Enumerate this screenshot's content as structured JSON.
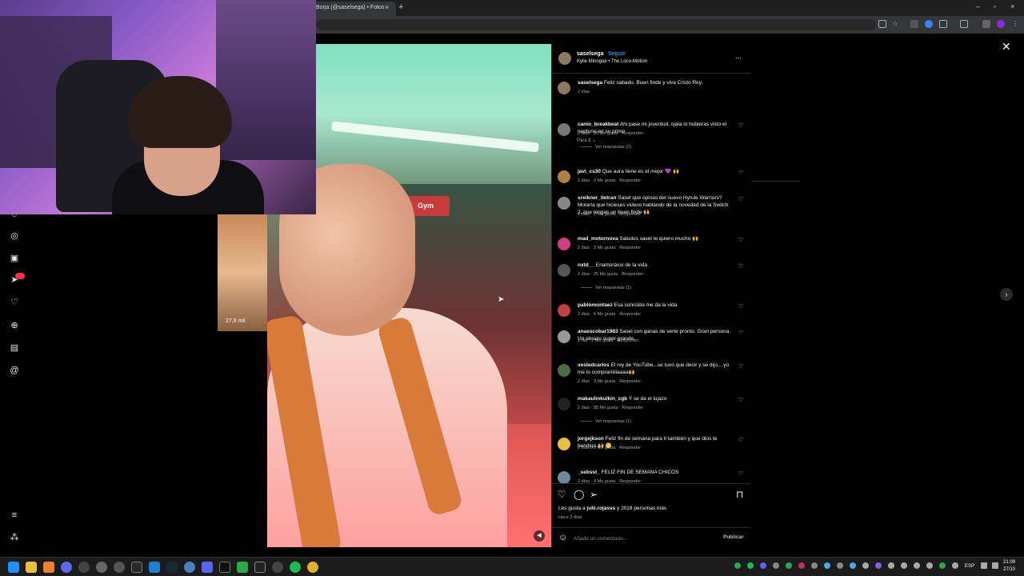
{
  "browser": {
    "tab_title": "Borja (@saselsega) • Fotos",
    "tab_close": "×",
    "new_tab": "+",
    "window_controls": [
      "–",
      "▫",
      "×"
    ]
  },
  "post": {
    "username": "saselsega",
    "follow_label": "Seguir",
    "song": "Kylie Minogue • The Loco-Motion",
    "more": "...",
    "mute_icon": "speaker-icon"
  },
  "thumbnail": {
    "views": "27,6 mil"
  },
  "caption": {
    "user": "saselsega",
    "text": "Feliz sabado. Buen finde y viva Cristo Rey.",
    "time": "2 días"
  },
  "sort_label": "Para ti",
  "comments": [
    {
      "user": "canio_breakbeat",
      "text": "Ahi pase mi juventud, ojala lo hubieras visto el neptuno en su prime",
      "time": "2 días",
      "likes": "16 Me gusta",
      "reply": "Responder",
      "replies": "Ver respuestas (2)"
    },
    {
      "user": "javi_cs30",
      "text": "Que aura tiene es el mejor 💜 🙌",
      "time": "2 días",
      "likes": "2 Me gusta",
      "reply": "Responder"
    },
    {
      "user": "sreikner_lletran",
      "text": "Sasel que opinas del nuevo Hyrule Warriors? Molaría que hicieses videos hablando de la novedad de la Switch 2, que tengas un buen finde 🙌",
      "time": "2 días",
      "likes": "2 Me gusta",
      "reply": "Responder"
    },
    {
      "user": "mad_motornova",
      "text": "Saludos sasel te quiero mucho 🙌",
      "time": "2 días",
      "likes": "3 Me gusta",
      "reply": "Responder"
    },
    {
      "user": "nxtd__",
      "text": "Enamoraico de la vida",
      "time": "2 días",
      "likes": "25 Me gusta",
      "reply": "Responder",
      "replies": "Ver respuestas (1)"
    },
    {
      "user": "pablomontaez",
      "text": "Esa sonrisilla me da la vida",
      "time": "2 días",
      "likes": "6 Me gusta",
      "reply": "Responder"
    },
    {
      "user": "anaescobar1983",
      "text": "Sasel con ganas de verte pronto. Gran persona. Un abrazo super grande.",
      "time": "1 día",
      "likes": "2 Me gusta",
      "reply": "Responder"
    },
    {
      "user": "vestedcarlos",
      "text": "El rey de YouTube...se tuvo que decir y se dijo....yo me lo compraríiiiiaaaa🙌",
      "time": "2 días",
      "likes": "3 Me gusta",
      "reply": "Responder"
    },
    {
      "user": "makaulinkulkin_cgb",
      "text": "Y se da el lujazo",
      "time": "2 días",
      "likes": "85 Me gusta",
      "reply": "Responder",
      "replies": "Ver respuestas (1)"
    },
    {
      "user": "jorgejkson",
      "text": "Feliz fin de semana para ti también y que dios te bendiga 🙌 😁",
      "time": "2 días",
      "likes": "2 Me gusta",
      "reply": "Responder"
    },
    {
      "user": "_sebsst_",
      "text": "FELIZ FIN DE SEMANA CHICOS",
      "time": "2 días",
      "likes": "4 Me gusta",
      "reply": "Responder"
    }
  ],
  "actions": {
    "like_icon": "heart-icon",
    "comment_icon": "comment-icon",
    "share_icon": "send-icon",
    "save_icon": "bookmark-icon",
    "likes_prefix": "Les gusta a",
    "likes_user": "julii.rojasss",
    "likes_suffix": "y 2018 personas más",
    "time": "Hace 2 días"
  },
  "comment_box": {
    "placeholder": "Añade un comentario...",
    "publish": "Publicar"
  },
  "store_sign": "Gym",
  "taskbar": {
    "lang": "ESP",
    "time": "21:09",
    "date": "27/10"
  },
  "colors": {
    "accent": "#0095f6",
    "panel_bg": "#000000",
    "badge": "#ff3040"
  }
}
